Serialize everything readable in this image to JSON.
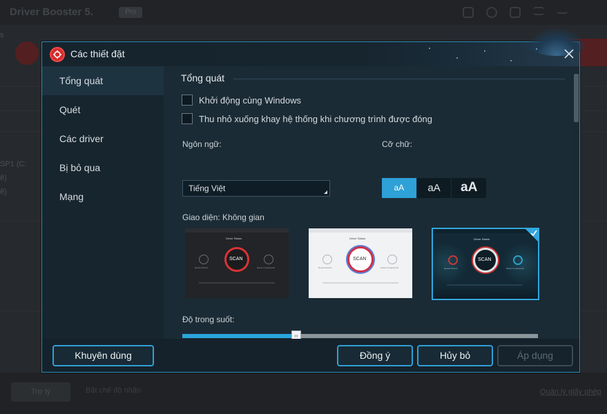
{
  "background_app": {
    "title": "Driver Booster 5.",
    "version_badge": "Pro",
    "left_texts": [
      "s",
      "SP1 (C:",
      "ẽ)",
      "ẽ)"
    ],
    "bottom_button": "Trợ lý",
    "bottom_text": "Bật chế độ nhận",
    "bottom_link": "Quản lý giấy phép"
  },
  "dialog": {
    "title": "Các thiết đặt",
    "sidebar": [
      {
        "label": "Tổng quát"
      },
      {
        "label": "Quét"
      },
      {
        "label": "Các driver"
      },
      {
        "label": "Bị bỏ qua"
      },
      {
        "label": "Mạng"
      }
    ],
    "section_title": "Tổng quát",
    "checkboxes": [
      {
        "label": "Khởi động cùng Windows"
      },
      {
        "label": "Thu nhỏ xuống khay hệ thống khi chương trình được đóng"
      }
    ],
    "language_label": "Ngôn ngữ:",
    "language_value": "Tiếng Việt",
    "font_size_label": "Cỡ chữ:",
    "font_sizes": [
      "aA",
      "aA",
      "aA"
    ],
    "font_size_selected_index": 0,
    "theme_label": "Giao diện: Không gian",
    "themes": [
      {
        "name": "dark",
        "scan_label": "SCAN",
        "driver_status": "Driver Status",
        "left_caption": "Device Drivers",
        "right_caption": "Game Components"
      },
      {
        "name": "light",
        "scan_label": "SCAN",
        "driver_status": "Driver Status",
        "left_caption": "Device Drivers",
        "right_caption": "Game Components"
      },
      {
        "name": "space",
        "scan_label": "SCAN",
        "driver_status": "Driver Status",
        "left_caption": "Device Drivers",
        "right_caption": "Game Components"
      }
    ],
    "theme_selected_index": 2,
    "transparency_label": "Độ trong suốt:",
    "transparency_value": 0.32,
    "buttons": {
      "recommended": "Khuyên dùng",
      "ok": "Đồng ý",
      "cancel": "Hủy bỏ",
      "apply": "Áp dụng"
    },
    "colors": {
      "accent": "#2ea1d6",
      "brand_red": "#d62d2d"
    }
  }
}
